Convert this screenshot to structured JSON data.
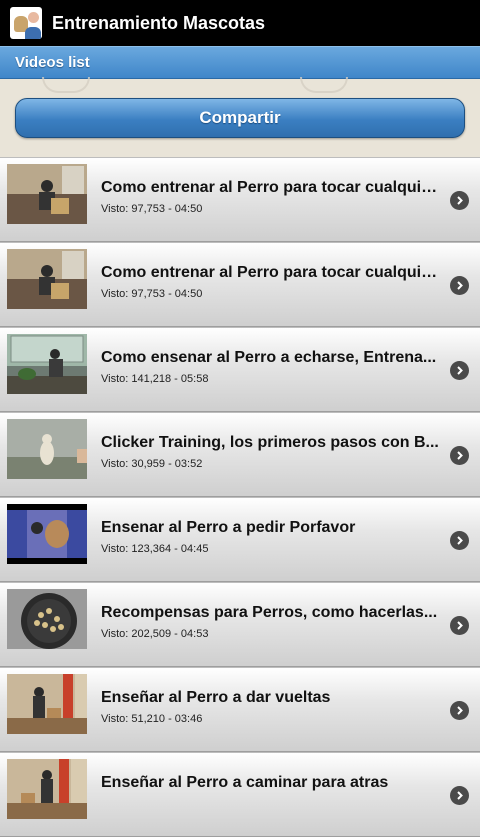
{
  "app": {
    "title": "Entrenamiento Mascotas"
  },
  "subheader": {
    "label": "Videos list"
  },
  "share_button": {
    "label": "Compartir"
  },
  "videos": [
    {
      "title": "Como entrenar al Perro para tocar cualquie...",
      "meta": "Visto: 97,753 - 04:50"
    },
    {
      "title": "Como entrenar al Perro para tocar cualquie...",
      "meta": "Visto: 97,753 - 04:50"
    },
    {
      "title": "Como ensenar al Perro a echarse, Entrena...",
      "meta": "Visto: 141,218 - 05:58"
    },
    {
      "title": "Clicker Training, los primeros pasos con B...",
      "meta": "Visto: 30,959 - 03:52"
    },
    {
      "title": "Ensenar al Perro a pedir Porfavor",
      "meta": "Visto: 123,364 - 04:45"
    },
    {
      "title": "Recompensas para Perros, como hacerlas...",
      "meta": "Visto: 202,509 - 04:53"
    },
    {
      "title": "Enseñar al Perro a dar vueltas",
      "meta": "Visto: 51,210 - 03:46"
    },
    {
      "title": "Enseñar al Perro a caminar para atras",
      "meta": ""
    }
  ]
}
